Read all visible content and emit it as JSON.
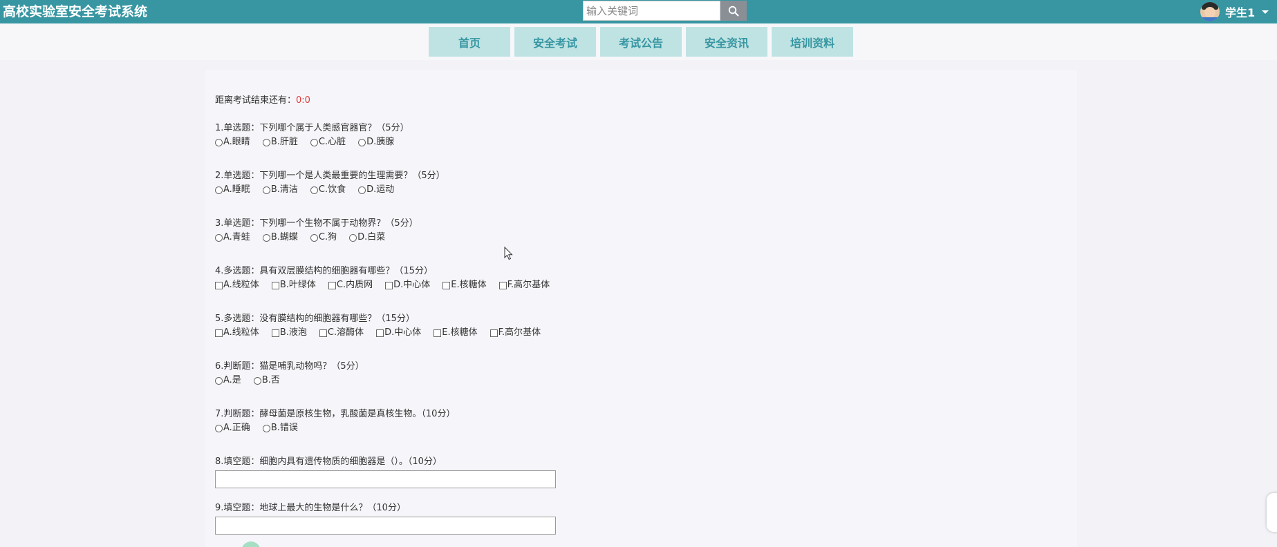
{
  "header": {
    "site_title": "高校实验室安全考试系统",
    "search_placeholder": "输入关键词",
    "user_name": "学生1"
  },
  "nav": [
    {
      "label": "首页"
    },
    {
      "label": "安全考试"
    },
    {
      "label": "考试公告"
    },
    {
      "label": "安全资讯"
    },
    {
      "label": "培训资料"
    }
  ],
  "exam": {
    "countdown_label": "距离考试结束还有：",
    "countdown_value": "0:0",
    "questions": [
      {
        "title": "1.单选题：下列哪个属于人类感官器官？（5分）",
        "kind": "radio",
        "options": [
          "A.眼睛",
          "B.肝脏",
          "C.心脏",
          "D.胰腺"
        ]
      },
      {
        "title": "2.单选题：下列哪一个是人类最重要的生理需要？（5分）",
        "kind": "radio",
        "options": [
          "A.睡眠",
          "B.清洁",
          "C.饮食",
          "D.运动"
        ]
      },
      {
        "title": "3.单选题：下列哪一个生物不属于动物界？（5分）",
        "kind": "radio",
        "options": [
          "A.青蛙",
          "B.蝴蝶",
          "C.狗",
          "D.白菜"
        ]
      },
      {
        "title": "4.多选题：具有双层膜结构的细胞器有哪些？（15分）",
        "kind": "checkbox",
        "options": [
          "A.线粒体",
          "B.叶绿体",
          "C.内质网",
          "D.中心体",
          "E.核糖体",
          "F.高尔基体"
        ]
      },
      {
        "title": "5.多选题：没有膜结构的细胞器有哪些？（15分）",
        "kind": "checkbox",
        "options": [
          "A.线粒体",
          "B.液泡",
          "C.溶酶体",
          "D.中心体",
          "E.核糖体",
          "F.高尔基体"
        ]
      },
      {
        "title": "6.判断题：猫是哺乳动物吗？（5分）",
        "kind": "radio",
        "options": [
          "A.是",
          "B.否"
        ]
      },
      {
        "title": "7.判断题：酵母菌是原核生物，乳酸菌是真核生物。（10分）",
        "kind": "radio",
        "options": [
          "A.正确",
          "B.错误"
        ]
      },
      {
        "title": "8.填空题：细胞内具有遗传物质的细胞器是（）。（10分）",
        "kind": "text",
        "options": []
      },
      {
        "title": "9.填空题：地球上最大的生物是什么？（10分）",
        "kind": "text",
        "options": []
      }
    ]
  }
}
